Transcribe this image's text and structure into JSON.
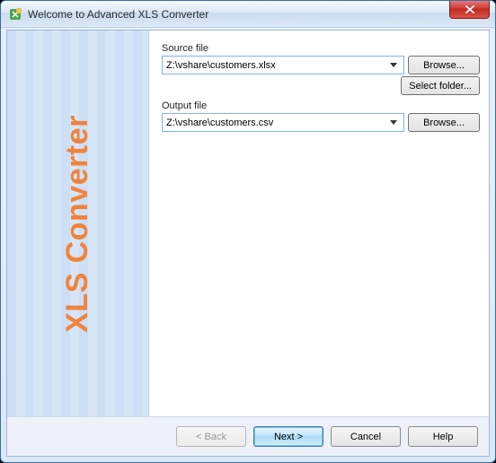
{
  "window": {
    "title": "Welcome to Advanced XLS Converter"
  },
  "sidebar": {
    "brand": "XLS Converter"
  },
  "form": {
    "source": {
      "label": "Source file",
      "value": "Z:\\vshare\\customers.xlsx",
      "browse": "Browse...",
      "select_folder": "Select folder..."
    },
    "output": {
      "label": "Output file",
      "value": "Z:\\vshare\\customers.csv",
      "browse": "Browse..."
    }
  },
  "wizard": {
    "back": "< Back",
    "next": "Next >",
    "cancel": "Cancel",
    "help": "Help"
  }
}
